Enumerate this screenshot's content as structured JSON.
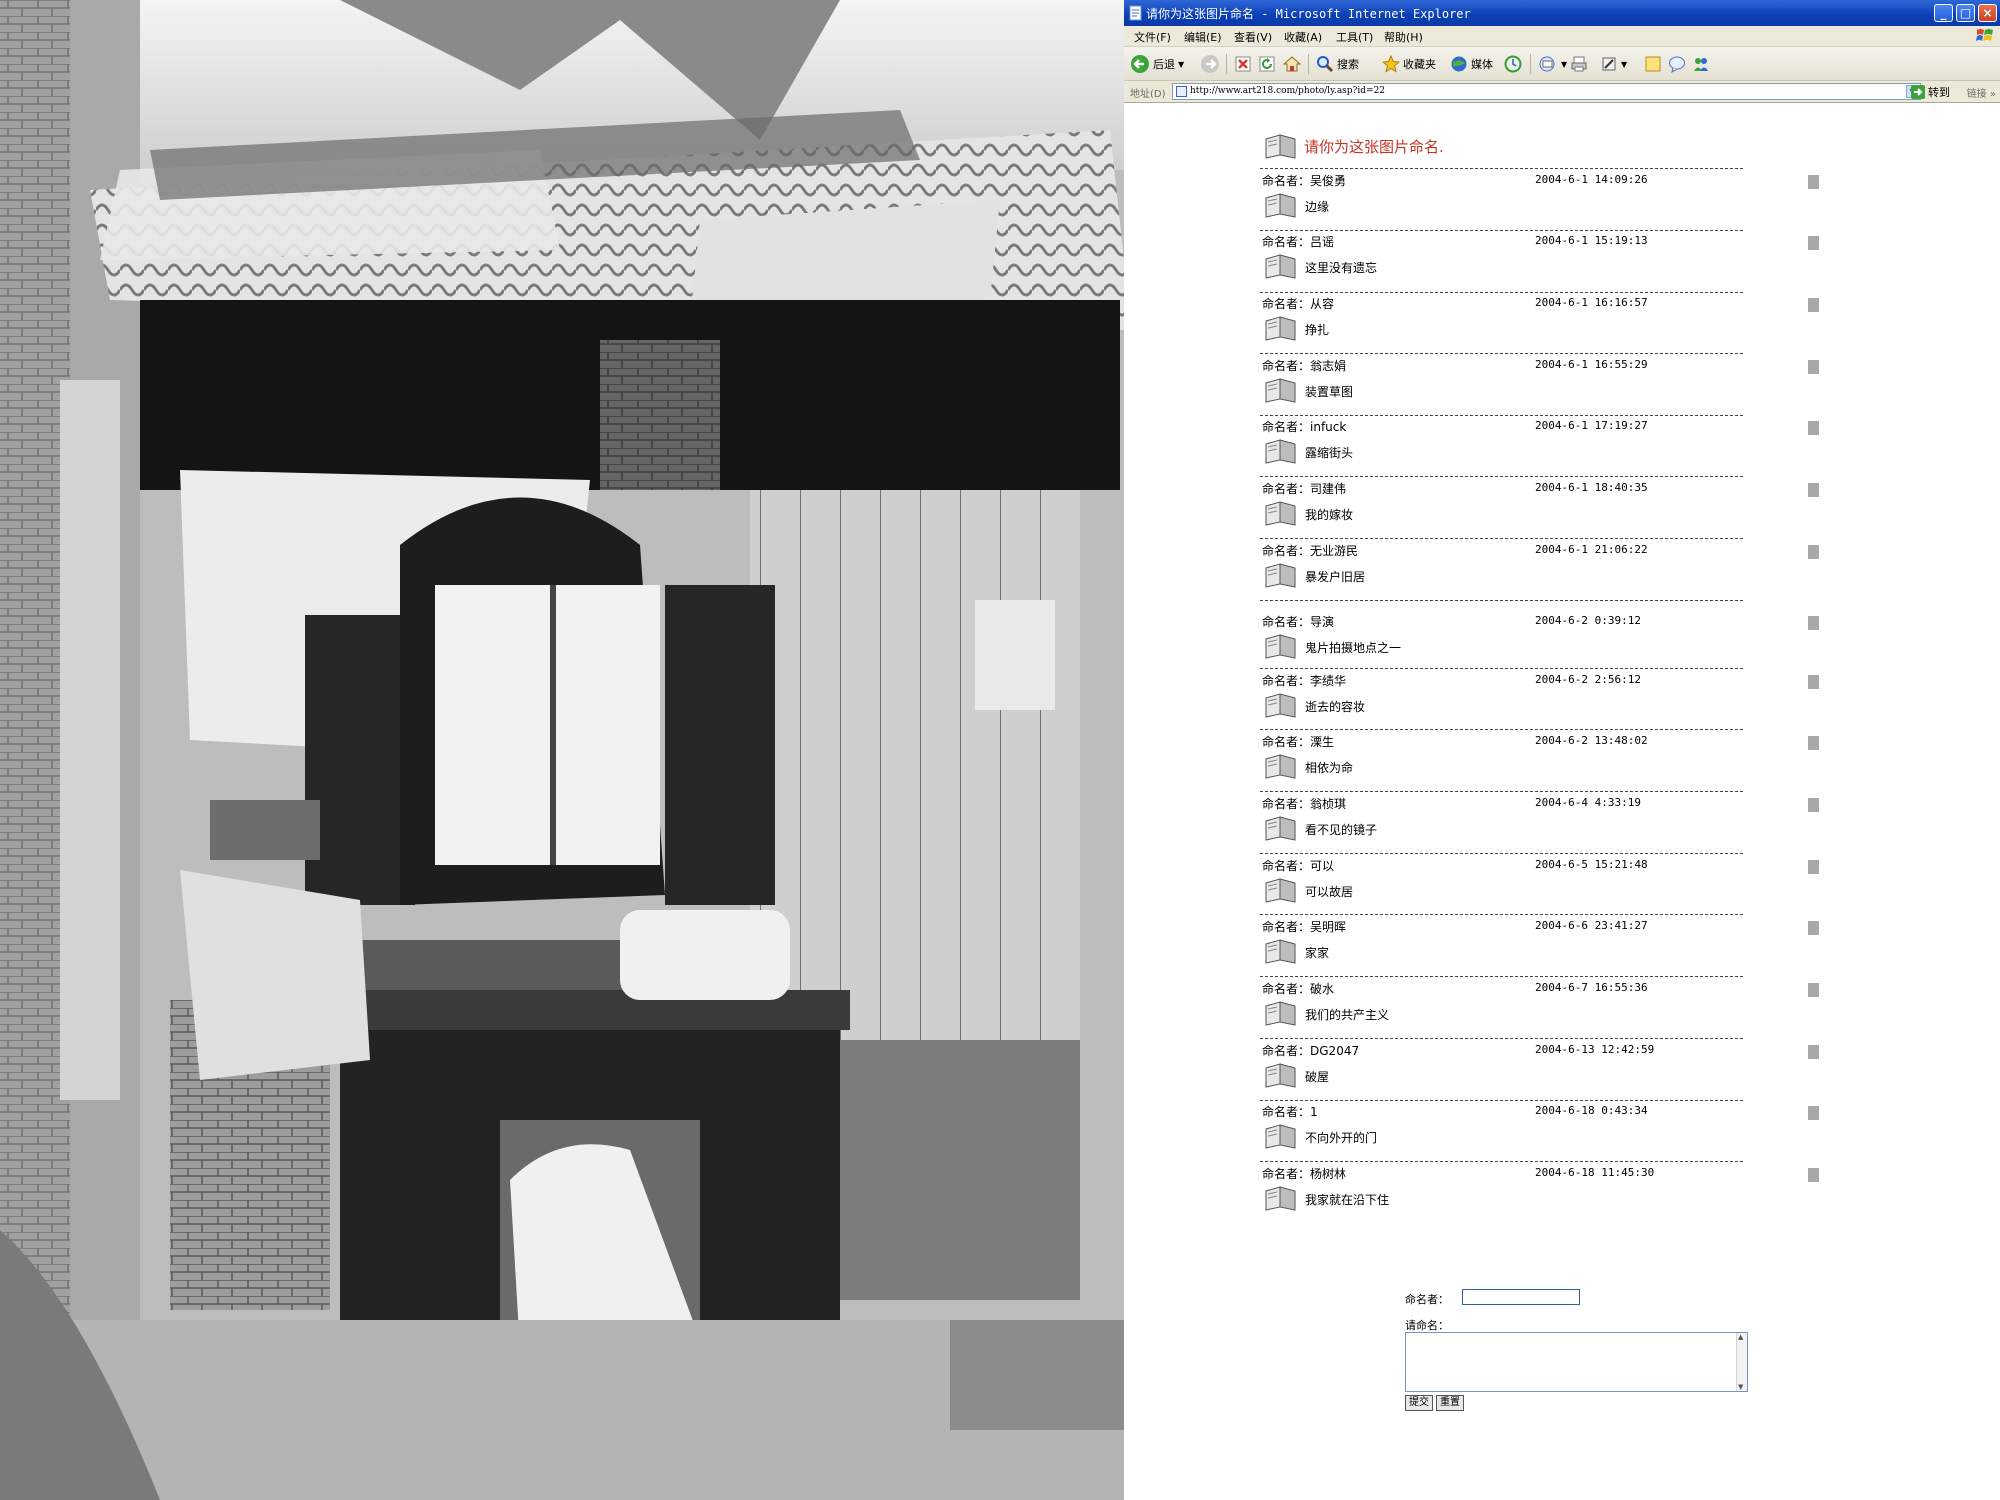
{
  "window": {
    "title": "请你为这张图片命名 - Microsoft Internet Explorer",
    "controls": {
      "minimize": "_",
      "maximize": "□",
      "close": "×"
    }
  },
  "menu": [
    "文件(F)",
    "编辑(E)",
    "查看(V)",
    "收藏(A)",
    "工具(T)",
    "帮助(H)"
  ],
  "toolbar": {
    "back": "后退",
    "search": "搜索",
    "favorites": "收藏夹",
    "media": "媒体"
  },
  "address": {
    "label": "地址(D)",
    "url": "http://www.art218.com/photo/ly.asp?id=22",
    "go": "转到",
    "links": "链接",
    "more": "»"
  },
  "page": {
    "heading": "请你为这张图片命名.",
    "name_prefix": "命名者：",
    "entries": [
      {
        "author": "吴俊勇",
        "time": "2004-6-1 14:09:26",
        "title": "边缘"
      },
      {
        "author": "吕谣",
        "time": "2004-6-1 15:19:13",
        "title": "这里没有遗忘"
      },
      {
        "author": "从容",
        "time": "2004-6-1 16:16:57",
        "title": "挣扎"
      },
      {
        "author": "翁志娟",
        "time": "2004-6-1 16:55:29",
        "title": "装置草图"
      },
      {
        "author": "infuck",
        "time": "2004-6-1 17:19:27",
        "title": "露缩街头"
      },
      {
        "author": "司建伟",
        "time": "2004-6-1 18:40:35",
        "title": "我的嫁妆"
      },
      {
        "author": "无业游民",
        "time": "2004-6-1 21:06:22",
        "title": "暴发户旧居"
      },
      {
        "author": "导演",
        "time": "2004-6-2 0:39:12",
        "title": "鬼片拍摄地点之一"
      },
      {
        "author": "李绩华",
        "time": "2004-6-2 2:56:12",
        "title": "逝去的容妆"
      },
      {
        "author": "溧生",
        "time": "2004-6-2 13:48:02",
        "title": "相依为命"
      },
      {
        "author": "翁桢琪",
        "time": "2004-6-4 4:33:19",
        "title": "看不见的镜子"
      },
      {
        "author": "可以",
        "time": "2004-6-5 15:21:48",
        "title": "可以故居"
      },
      {
        "author": "吴明晖",
        "time": "2004-6-6 23:41:27",
        "title": "家家"
      },
      {
        "author": "破水",
        "time": "2004-6-7 16:55:36",
        "title": "我们的共产主义"
      },
      {
        "author": "DG2047",
        "time": "2004-6-13 12:42:59",
        "title": "破屋"
      },
      {
        "author": "1",
        "time": "2004-6-18 0:43:34",
        "title": "不向外开的门"
      },
      {
        "author": "杨树林",
        "time": "2004-6-18 11:45:30",
        "title": "我家就在沿下住"
      }
    ],
    "form": {
      "name_label": "命名者：",
      "title_label": "请命名：",
      "name_value": "",
      "title_value": "",
      "submit": "提交",
      "reset": "重置"
    }
  },
  "colors": {
    "titlebar": "#0a3fb6",
    "chrome": "#ece9d8",
    "heading_red": "#c43322"
  },
  "icons": {
    "entry": "book-icon",
    "square": "grey-square-icon"
  }
}
